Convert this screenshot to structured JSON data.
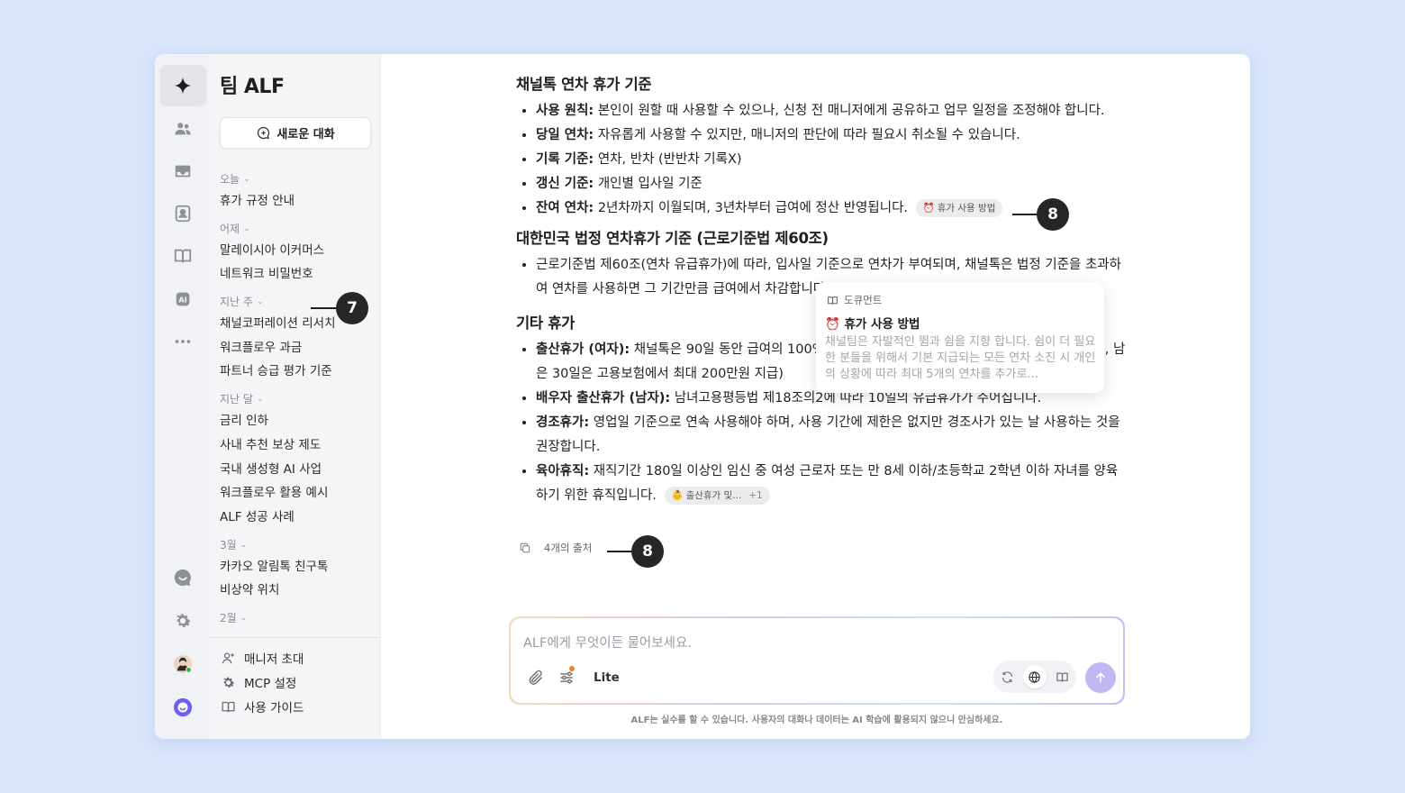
{
  "app": {
    "title": "팀 ALF",
    "new_chat": "새로운 대화"
  },
  "sidebar": {
    "groups": [
      {
        "label": "오늘",
        "items": [
          "휴가 규정 안내"
        ]
      },
      {
        "label": "어제",
        "items": [
          "말레이시아 이커머스",
          "네트워크 비밀번호"
        ]
      },
      {
        "label": "지난 주",
        "items": [
          "채널코퍼레이션 리서치",
          "워크플로우 과금",
          "파트너 승급 평가 기준"
        ]
      },
      {
        "label": "지난 달",
        "items": [
          "금리 인하",
          "사내 추천 보상 제도",
          "국내 생성형 AI 사업",
          "워크플로우 활용 예시",
          "ALF 성공 사례"
        ]
      },
      {
        "label": "3월",
        "items": [
          "카카오 알림톡 친구톡",
          "비상약 위치"
        ]
      },
      {
        "label": "2월",
        "items": []
      }
    ],
    "bottom": {
      "invite": "매니저 초대",
      "mcp": "MCP 설정",
      "guide": "사용 가이드"
    }
  },
  "content": {
    "s1_title": "채널톡 연차 휴가 기준",
    "s1": [
      {
        "b": "사용 원칙:",
        "t": " 본인이 원할 때 사용할 수 있으나, 신청 전 매니저에게 공유하고 업무 일정을 조정해야 합니다."
      },
      {
        "b": "당일 연차:",
        "t": " 자유롭게 사용할 수 있지만, 매니저의 판단에 따라 필요시 취소될 수 있습니다."
      },
      {
        "b": "기록 기준:",
        "t": " 연차, 반차 (반반차 기록X)"
      },
      {
        "b": "갱신 기준:",
        "t": " 개인별 입사일 기준"
      },
      {
        "b": "잔여 연차:",
        "t": " 2년차까지 이월되며, 3년차부터 급여에 정산 반영됩니다.",
        "chip": "휴가 사용 방법"
      }
    ],
    "s2_title": "대한민국 법정 연차휴가 기준 (근로기준법 제60조)",
    "s2_text": "근로기준법 제60조(연차 유급휴가)에 따라, 입사일 기준으로 연차가 부여되며, 채널톡은 법정 기준을 초과하여 연차를 사용하면 그 기간만큼 급여에서 차감합니다.",
    "s3_title": "기타 휴가",
    "s3": [
      {
        "b": "출산휴가 (여자):",
        "t": " 채널톡은 90일 동안 급여의 100%를 지급합니다. (일반적으로 첫 60일은 급여 100%, 남은 30일은 고용보험에서 최대 200만원 지급)"
      },
      {
        "b": "배우자 출산휴가 (남자):",
        "t": " 남녀고용평등법 제18조의2에 따라 10일의 유급휴가가 주어집니다."
      },
      {
        "b": "경조휴가:",
        "t": " 영업일 기준으로 연속 사용해야 하며, 사용 기간에 제한은 없지만 경조사가 있는 날 사용하는 것을 권장합니다."
      },
      {
        "b": "육아휴직:",
        "t": " 재직기간 180일 이상인 임신 중 여성 근로자 또는 만 8세 이하/초등학교 2학년 이하 자녀를 양육하기 위한 휴직입니다.",
        "chip": "출산휴가 및...",
        "chip_extra": "+1"
      }
    ],
    "sources": "4개의 출처"
  },
  "tooltip": {
    "category": "도큐먼트",
    "title": "휴가 사용 방법",
    "snippet": "채널팀은 자발적인 뜀과 쉼을 지향 합니다.  쉼이 더 필요한 분들을 위해서 기본 지급되는 모든 연차 소진 시 개인의 상황에 따라 최대 5개의 연차를 추가로..."
  },
  "input": {
    "placeholder": "ALF에게 무엇이든 물어보세요.",
    "mode": "Lite"
  },
  "disclaimer": "ALF는 실수를 할 수 있습니다. 사용자의 대화나 데이터는 AI 학습에 활용되지 않으니 안심하세요.",
  "callouts": {
    "c7": "7",
    "c8a": "8",
    "c8b": "8"
  },
  "colors": {
    "accent": "#c1b7f3",
    "background": "#d8e5fb",
    "callout": "#262626"
  }
}
